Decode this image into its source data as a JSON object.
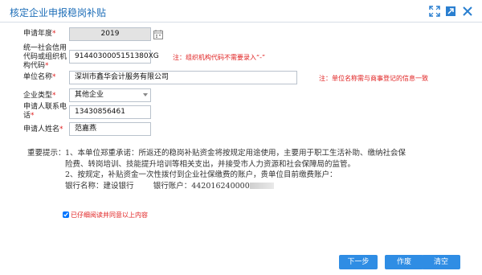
{
  "dialog": {
    "title": "核定企业申报稳岗补贴"
  },
  "icons": {
    "expand": "expand-icon",
    "maximize": "maximize-icon",
    "close": "close-icon",
    "calendar": "calendar-icon"
  },
  "form": {
    "year": {
      "label": "申请年度",
      "required": "*",
      "value": "2019"
    },
    "credit_code": {
      "label_lines": [
        "统一社会信用",
        "代码或组织机",
        "构代码"
      ],
      "required": "*",
      "value": "9144030005151380XG",
      "hint": "注：组织机构代码不需要录入“-”"
    },
    "company_name": {
      "label": "单位名称",
      "required": "*",
      "value": "深圳市鑫华会计服务有限公司",
      "hint": "注：单位名称需与商事登记的信息一致"
    },
    "company_type": {
      "label": "企业类型",
      "required": "*",
      "value": "其他企业"
    },
    "phone": {
      "label_lines": [
        "申请人联系电",
        "话"
      ],
      "required": "*",
      "value": "13430856461"
    },
    "applicant": {
      "label": "申请人姓名",
      "required": "*",
      "value": "范嘉燕"
    }
  },
  "notice": {
    "heading": "重要提示：",
    "p1": "1、本单位郑重承诺：所返还的稳岗补贴资金将按规定用途使用，主要用于职工生活补助、缴纳社会保险费、转岗培训、技能提升培训等相关支出，并接受市人力资源和社会保障局的监管。",
    "p2": "2、按规定，补贴资金一次性拨付到企业社保缴费的账户，贵单位目前缴费账户：",
    "bank_label": "银行名称：",
    "bank_value": "建设银行",
    "account_label": "银行账户：",
    "account_value": "442016240000"
  },
  "agree": {
    "label": "已仔细阅读并同意以上内容",
    "checked": true
  },
  "buttons": {
    "next": "下一步",
    "cancel": "作废",
    "clear": "清空"
  },
  "colors": {
    "title": "#1e6eb8",
    "required": "#e02020",
    "button": "#2f8de4"
  }
}
